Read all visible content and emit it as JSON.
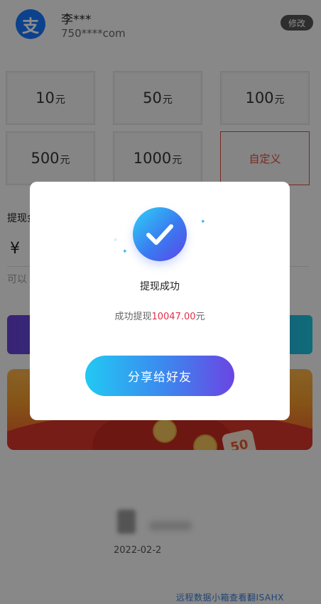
{
  "header": {
    "logo_char": "支",
    "user_name": "李***",
    "account": "750****com",
    "modify_label": "修改"
  },
  "amounts": [
    {
      "value": "10",
      "unit": "元"
    },
    {
      "value": "50",
      "unit": "元"
    },
    {
      "value": "100",
      "unit": "元"
    },
    {
      "value": "500",
      "unit": "元"
    },
    {
      "value": "1000",
      "unit": "元"
    }
  ],
  "custom_label": "自定义",
  "withdraw_label": "提现金",
  "currency_symbol": "¥",
  "hint_text": "可以",
  "footer": {
    "date": "2022-02-2",
    "watermark": "远程数据小箱查看翻ISAHX"
  },
  "banner": {
    "badge": "50"
  },
  "modal": {
    "title": "提现成功",
    "msg_prefix": "成功提现",
    "amount": "10047.00",
    "msg_suffix": "元",
    "share_label": "分享给好友"
  },
  "colors": {
    "accent_blue": "#3a7bf0",
    "amount_red": "#e0304b",
    "custom_red": "#e04a3a"
  },
  "icons": [
    "alipay-logo",
    "check-icon",
    "sparkle-icon"
  ]
}
